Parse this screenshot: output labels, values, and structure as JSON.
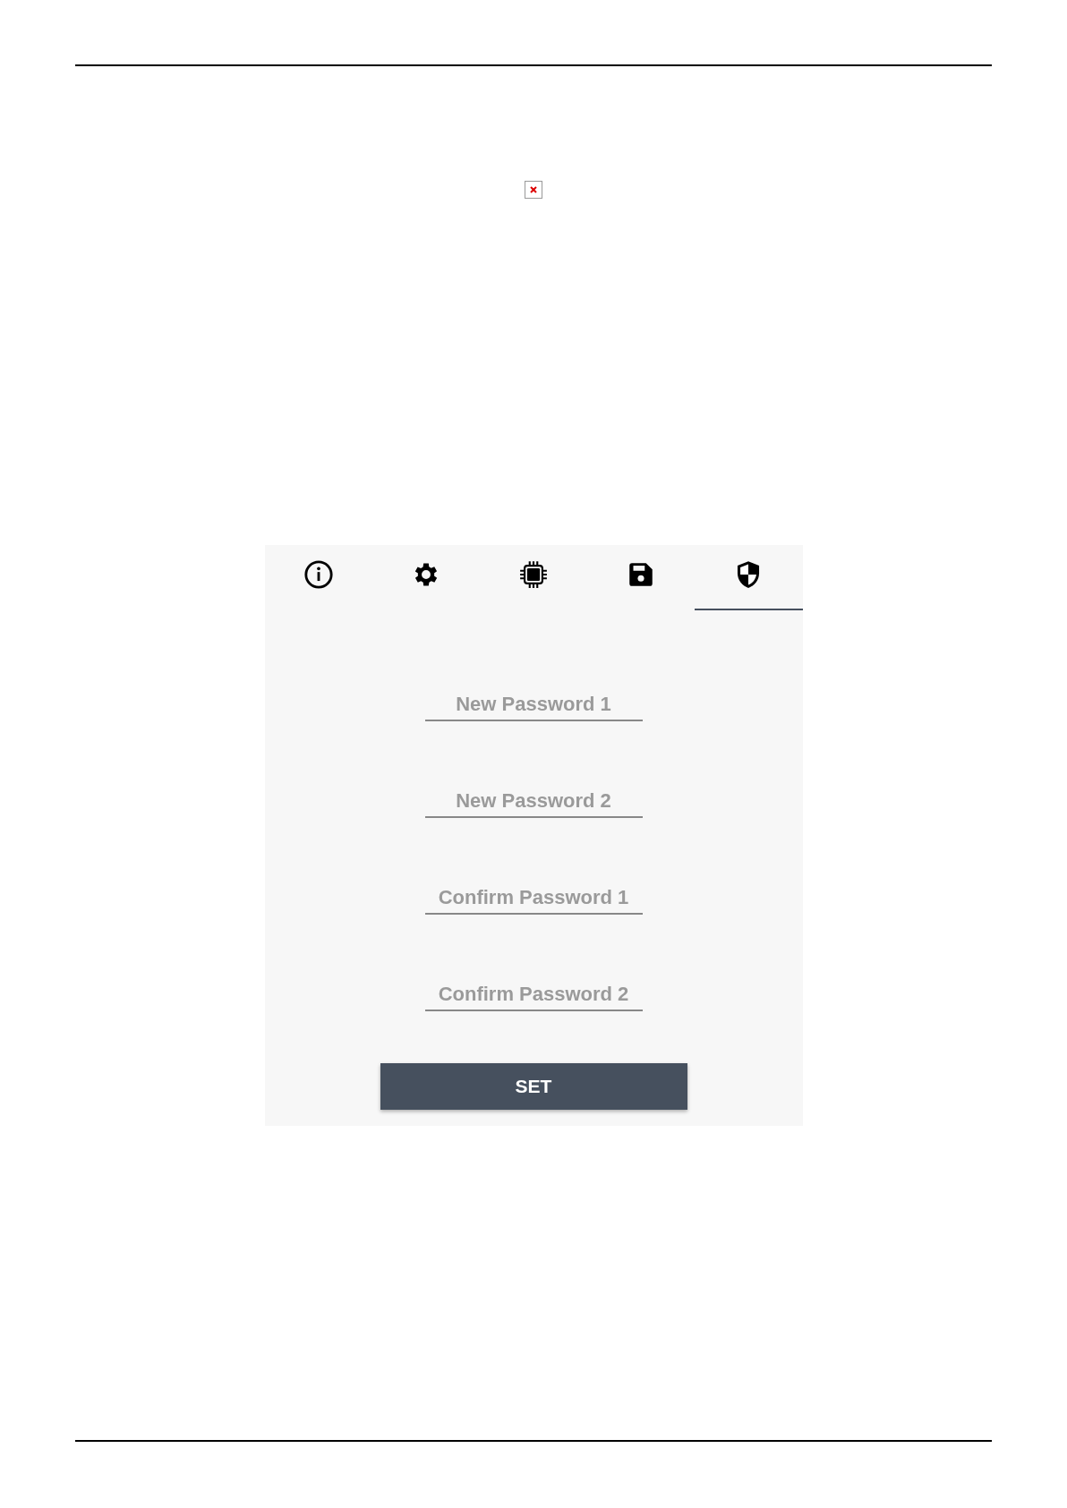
{
  "tabs": [
    {
      "kind": "info",
      "selected": false
    },
    {
      "kind": "settings",
      "selected": false
    },
    {
      "kind": "chip",
      "selected": false
    },
    {
      "kind": "save",
      "selected": false
    },
    {
      "kind": "security",
      "selected": true
    }
  ],
  "fields": [
    {
      "placeholder": "New Password 1"
    },
    {
      "placeholder": "New Password 2"
    },
    {
      "placeholder": "Confirm Password 1"
    },
    {
      "placeholder": "Confirm Password 2"
    }
  ],
  "button": "SET"
}
